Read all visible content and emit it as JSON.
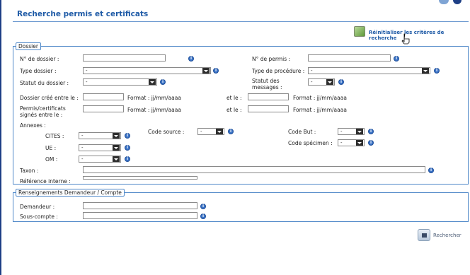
{
  "page": {
    "title": "Recherche permis et certificats"
  },
  "toolbar": {
    "reset_label": "Réinitialiser les critères de recherche",
    "search_label": "Rechercher"
  },
  "dossier": {
    "legend": "Dossier",
    "no_dossier_label": "N° de dossier :",
    "no_permis_label": "N° de permis :",
    "type_dossier_label": "Type dossier :",
    "type_dossier_value": "-",
    "type_procedure_label": "Type de procédure :",
    "type_procedure_value": "-",
    "statut_dossier_label": "Statut du dossier :",
    "statut_dossier_value": "-",
    "statut_messages_label": "Statut des messages :",
    "statut_messages_value": "-",
    "dossier_cree_label": "Dossier créé entre le :",
    "format_label": "Format : jj/mm/aaaa",
    "et_le_label": "et le :",
    "permis_signes_label": "Permis/certificats signés entre le :",
    "annexes_label": "Annexes :",
    "cites_label": "CITES :",
    "ue_label": "UE :",
    "om_label": "OM :",
    "code_source_label": "Code source :",
    "code_but_label": "Code But :",
    "code_specimen_label": "Code spécimen :",
    "taxon_label": "Taxon :",
    "ref_interne_label": "Référence interne :",
    "dash": "-"
  },
  "demandeur": {
    "legend": "Renseignements Demandeur / Compte",
    "demandeur_label": "Demandeur :",
    "sous_compte_label": "Sous-compte :"
  }
}
